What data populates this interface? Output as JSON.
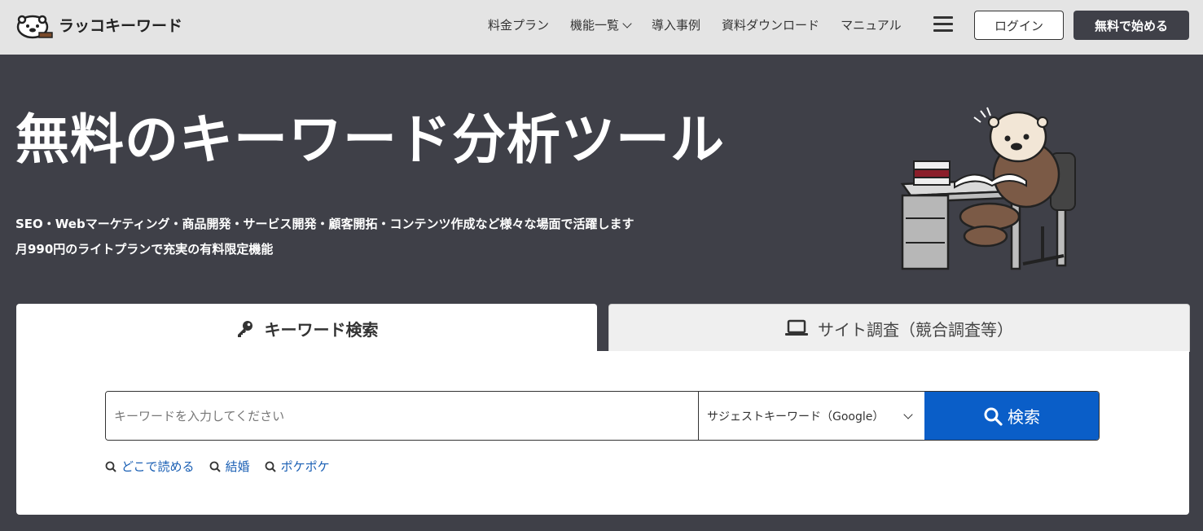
{
  "header": {
    "logo_text": "ラッコキーワード",
    "nav": [
      {
        "label": "料金プラン",
        "has_dropdown": false
      },
      {
        "label": "機能一覧",
        "has_dropdown": true
      },
      {
        "label": "導入事例",
        "has_dropdown": false
      },
      {
        "label": "資料ダウンロード",
        "has_dropdown": false
      },
      {
        "label": "マニュアル",
        "has_dropdown": false
      }
    ],
    "menu_icon": "hamburger-icon",
    "login_label": "ログイン",
    "start_label": "無料で始める"
  },
  "hero": {
    "title": "無料のキーワード分析ツール",
    "subtitle_line1": "SEO・Webマーケティング・商品開発・サービス開発・顧客開拓・コンテンツ作成など様々な場面で活躍します",
    "subtitle_line2": "月990円のライトプランで充実の有料限定機能"
  },
  "tabs": [
    {
      "label": "キーワード検索",
      "icon": "key-icon",
      "active": true
    },
    {
      "label": "サイト調査（競合調査等）",
      "icon": "laptop-icon",
      "active": false
    }
  ],
  "search": {
    "placeholder": "キーワードを入力してください",
    "value": "",
    "select_value": "サジェストキーワード（Google）",
    "button_label": "検索"
  },
  "suggestions": [
    "どこで読める",
    "結婚",
    "ポケポケ"
  ],
  "colors": {
    "header_bg": "#e4e4e4",
    "hero_bg": "#3f4048",
    "accent": "#0a5ec8",
    "link": "#1a5fb4"
  }
}
